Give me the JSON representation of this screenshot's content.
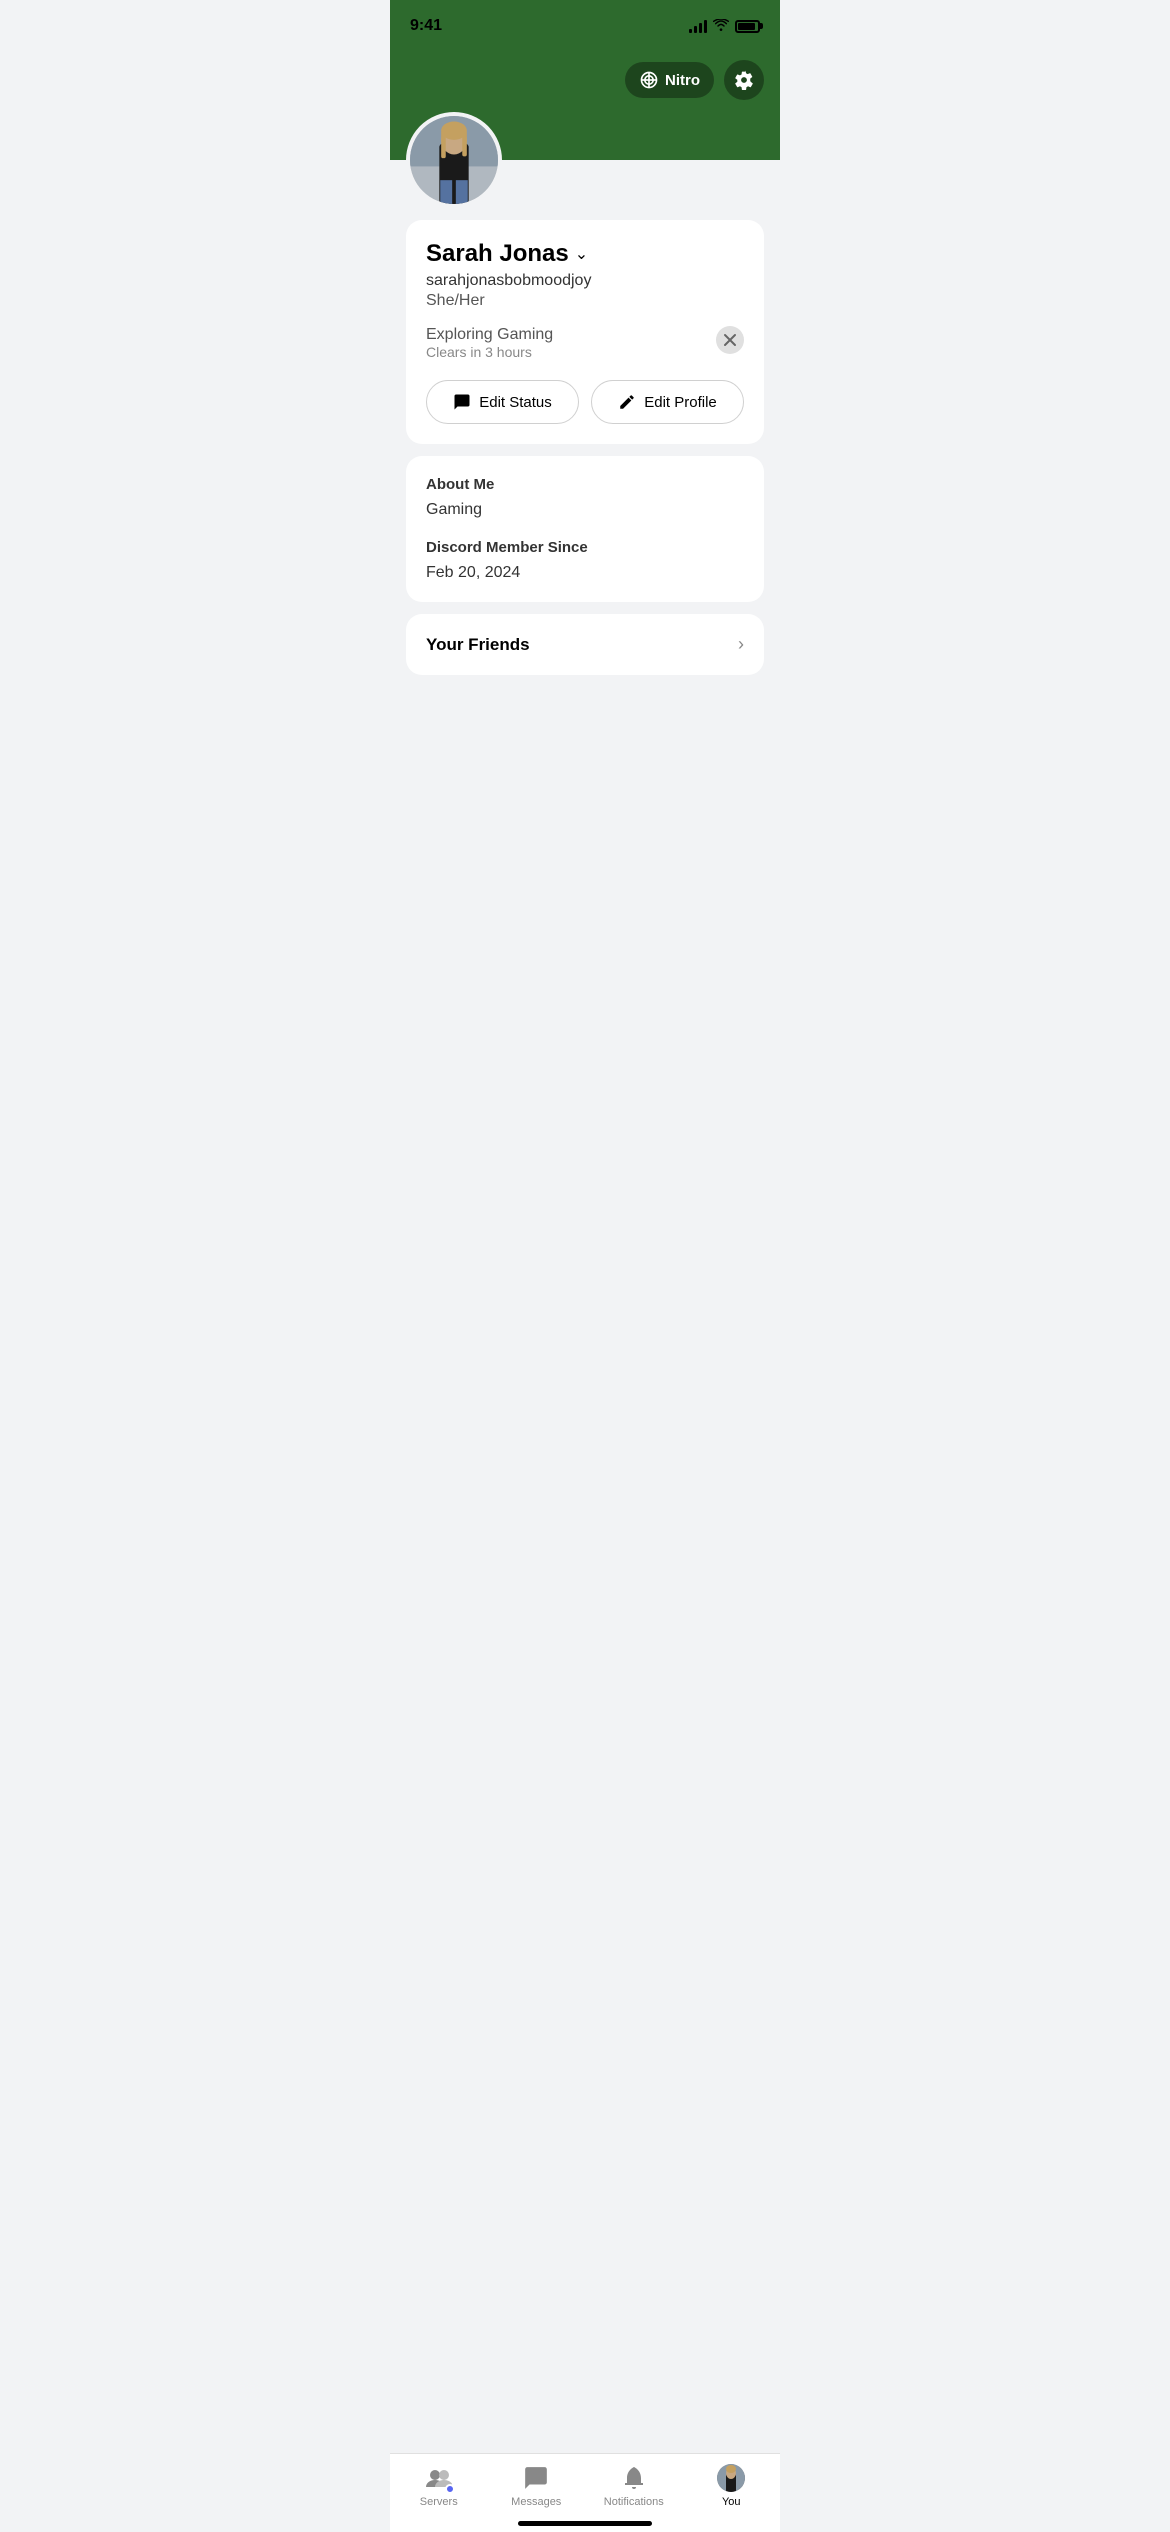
{
  "statusBar": {
    "time": "9:41"
  },
  "header": {
    "nitroLabel": "Nitro",
    "settingsAriaLabel": "Settings"
  },
  "profile": {
    "displayName": "Sarah Jonas",
    "username": "sarahjonasbobmoodjoy",
    "pronouns": "She/Her",
    "status": "Exploring Gaming",
    "statusClears": "Clears in 3 hours",
    "editStatusLabel": "Edit Status",
    "editProfileLabel": "Edit Profile"
  },
  "aboutMe": {
    "sectionTitle": "About Me",
    "text": "Gaming",
    "memberSinceTitle": "Discord Member Since",
    "memberSinceDate": "Feb 20, 2024"
  },
  "friends": {
    "label": "Your Friends"
  },
  "bottomNav": {
    "serversLabel": "Servers",
    "messagesLabel": "Messages",
    "notificationsLabel": "Notifications",
    "youLabel": "You"
  }
}
